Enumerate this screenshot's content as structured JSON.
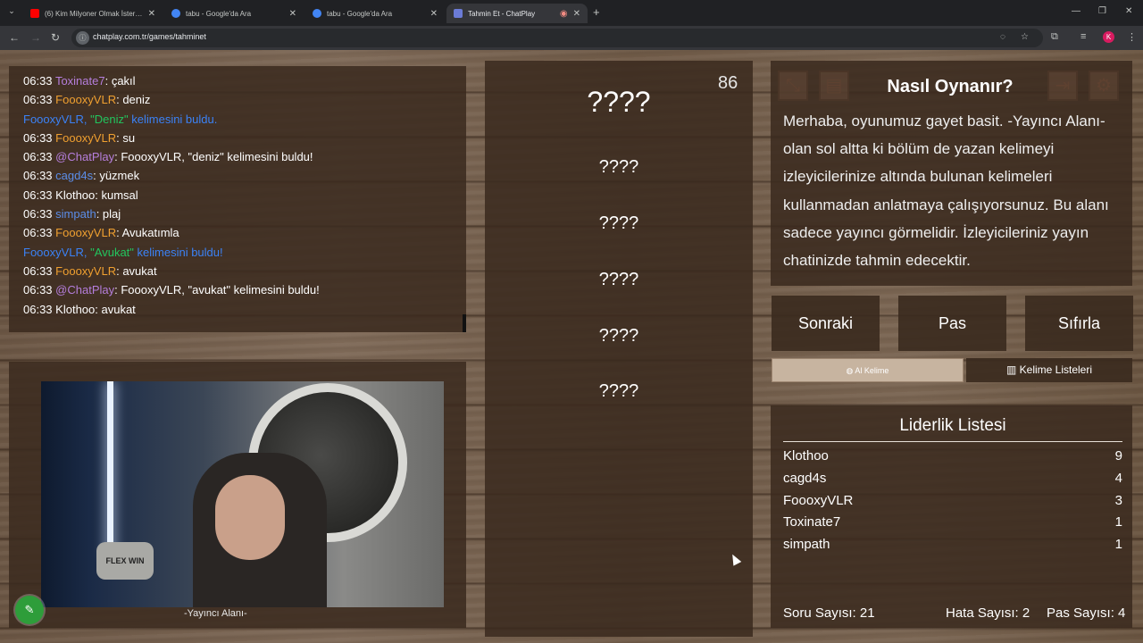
{
  "browser": {
    "tabs": [
      {
        "title": "(6) Kim Milyoner Olmak İster? S",
        "favicon_color": "#ff0000"
      },
      {
        "title": "tabu - Google'da Ara",
        "favicon_color": "#4285f4"
      },
      {
        "title": "tabu - Google'da Ara",
        "favicon_color": "#4285f4"
      },
      {
        "title": "Tahmin Et - ChatPlay",
        "favicon_color": "#6b7bd6"
      }
    ],
    "address": "chatplay.com.tr/games/tahminet",
    "profile_initial": "K"
  },
  "chat": {
    "messages": [
      {
        "type": "msg",
        "time": "06:33",
        "user": "Toxinate7",
        "user_color": "#b57edc",
        "text": ": çakıl"
      },
      {
        "type": "msg",
        "time": "06:33",
        "user": "FoooxyVLR",
        "user_color": "#f0a030",
        "text": ": deniz"
      },
      {
        "type": "sys",
        "user": "FoooxyVLR,",
        "word": " \"Deniz\" ",
        "text": "kelimesini buldu."
      },
      {
        "type": "msg",
        "time": "06:33",
        "user": "FoooxyVLR",
        "user_color": "#f0a030",
        "text": ": su"
      },
      {
        "type": "msg",
        "time": "06:33",
        "user": "@ChatPlay",
        "user_color": "#b57edc",
        "text": ": FoooxyVLR, \"deniz\" kelimesini buldu!"
      },
      {
        "type": "msg",
        "time": "06:33",
        "user": "cagd4s",
        "user_color": "#5b8de8",
        "text": ": yüzmek"
      },
      {
        "type": "msg",
        "time": "06:33",
        "user": "Klothoo",
        "user_color": "#ffffff",
        "text": ": kumsal"
      },
      {
        "type": "msg",
        "time": "06:33",
        "user": "simpath",
        "user_color": "#5b8de8",
        "text": ": plaj"
      },
      {
        "type": "msg",
        "time": "06:33",
        "user": "FoooxyVLR",
        "user_color": "#f0a030",
        "text": ": Avukatımla"
      },
      {
        "type": "sys",
        "user": "FoooxyVLR,",
        "word": " \"Avukat\" ",
        "text": "kelimesini buldu!"
      },
      {
        "type": "msg",
        "time": "06:33",
        "user": "FoooxyVLR",
        "user_color": "#f0a030",
        "text": ": avukat"
      },
      {
        "type": "msg",
        "time": "06:33",
        "user": "@ChatPlay",
        "user_color": "#b57edc",
        "text": ": FoooxyVLR, \"avukat\" kelimesini buldu!"
      },
      {
        "type": "msg",
        "time": "06:33",
        "user": "Klothoo",
        "user_color": "#ffffff",
        "text": ": avukat"
      }
    ]
  },
  "streamer": {
    "label": "-Yayıncı Alanı-",
    "pillow_text": "FLEX WIN"
  },
  "words": {
    "main": "????",
    "forbidden": [
      "????",
      "????",
      "????",
      "????",
      "????"
    ],
    "timer": "86"
  },
  "howto": {
    "title": "Nasıl Oynanır?",
    "text": "Merhaba, oyunumuz gayet basit. -Yayıncı Alanı- olan sol altta ki bölüm de yazan kelimeyi izleyicilerinize altında bulunan kelimeleri kullanmadan anlatmaya çalışıyorsunuz. Bu alanı sadece yayıncı görmelidir. İzleyicileriniz yayın chatinizde tahmin edecektir."
  },
  "controls": {
    "next": "Sonraki",
    "pass": "Pas",
    "reset": "Sıfırla",
    "ai_word": "Al Kelime",
    "word_lists": "Kelime Listeleri"
  },
  "leaderboard": {
    "title": "Liderlik Listesi",
    "rows": [
      {
        "name": "Klothoo",
        "score": "9"
      },
      {
        "name": "cagd4s",
        "score": "4"
      },
      {
        "name": "FoooxyVLR",
        "score": "3"
      },
      {
        "name": "Toxinate7",
        "score": "1"
      },
      {
        "name": "simpath",
        "score": "1"
      }
    ],
    "questions": "Soru Sayısı: 21",
    "errors": "Hata Sayısı: 2",
    "passes": "Pas Sayısı: 4"
  }
}
